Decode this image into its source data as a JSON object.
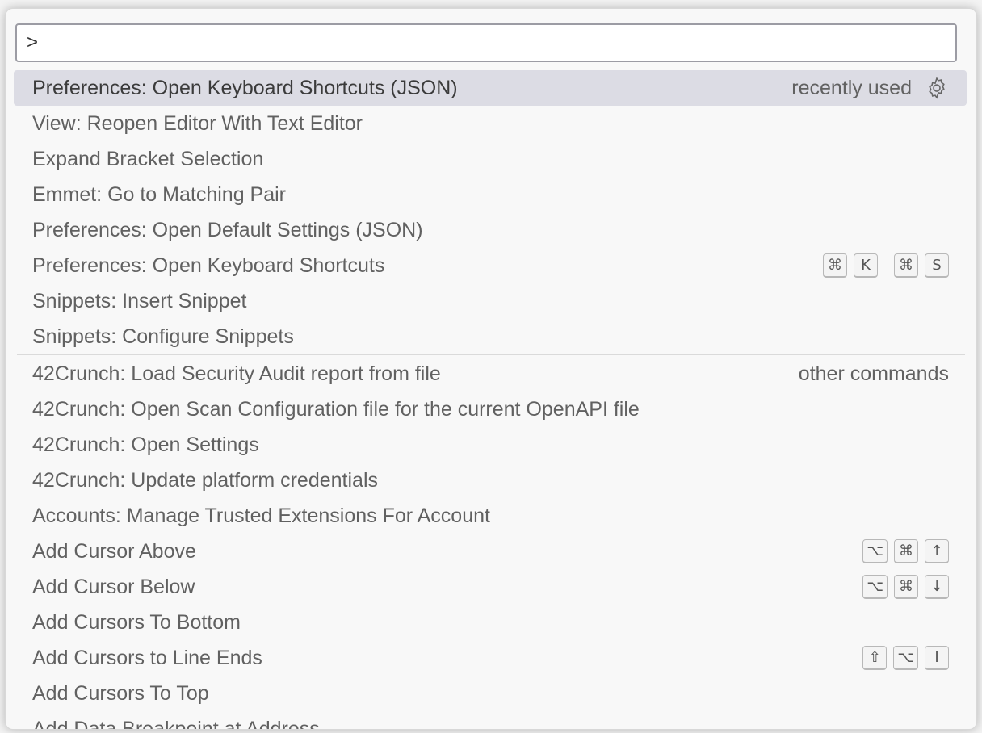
{
  "command_palette": {
    "input": {
      "value": ">",
      "placeholder": ""
    },
    "items": [
      {
        "label": "Preferences: Open Keyboard Shortcuts (JSON)",
        "group_label": "recently used",
        "has_gear": true,
        "selected": true,
        "keys": []
      },
      {
        "label": "View: Reopen Editor With Text Editor",
        "keys": []
      },
      {
        "label": "Expand Bracket Selection",
        "keys": []
      },
      {
        "label": "Emmet: Go to Matching Pair",
        "keys": []
      },
      {
        "label": "Preferences: Open Default Settings (JSON)",
        "keys": []
      },
      {
        "label": "Preferences: Open Keyboard Shortcuts",
        "keys": [
          [
            "⌘",
            "K"
          ],
          [
            "⌘",
            "S"
          ]
        ]
      },
      {
        "label": "Snippets: Insert Snippet",
        "keys": []
      },
      {
        "label": "Snippets: Configure Snippets",
        "keys": []
      },
      {
        "label": "42Crunch: Load Security Audit report from file",
        "group_label": "other commands",
        "keys": []
      },
      {
        "label": "42Crunch: Open Scan Configuration file for the current OpenAPI file",
        "keys": []
      },
      {
        "label": "42Crunch: Open Settings",
        "keys": []
      },
      {
        "label": "42Crunch: Update platform credentials",
        "keys": []
      },
      {
        "label": "Accounts: Manage Trusted Extensions For Account",
        "keys": []
      },
      {
        "label": "Add Cursor Above",
        "keys": [
          [
            "⌥",
            "⌘",
            "↑"
          ]
        ]
      },
      {
        "label": "Add Cursor Below",
        "keys": [
          [
            "⌥",
            "⌘",
            "↓"
          ]
        ]
      },
      {
        "label": "Add Cursors To Bottom",
        "keys": []
      },
      {
        "label": "Add Cursors to Line Ends",
        "keys": [
          [
            "⇧",
            "⌥",
            "I"
          ]
        ]
      },
      {
        "label": "Add Cursors To Top",
        "keys": []
      },
      {
        "label": "Add Data Breakpoint at Address",
        "keys": []
      }
    ]
  },
  "colors": {
    "selected_bg": "#dcdce4",
    "palette_bg": "#f8f8f8",
    "text": "#616161"
  }
}
